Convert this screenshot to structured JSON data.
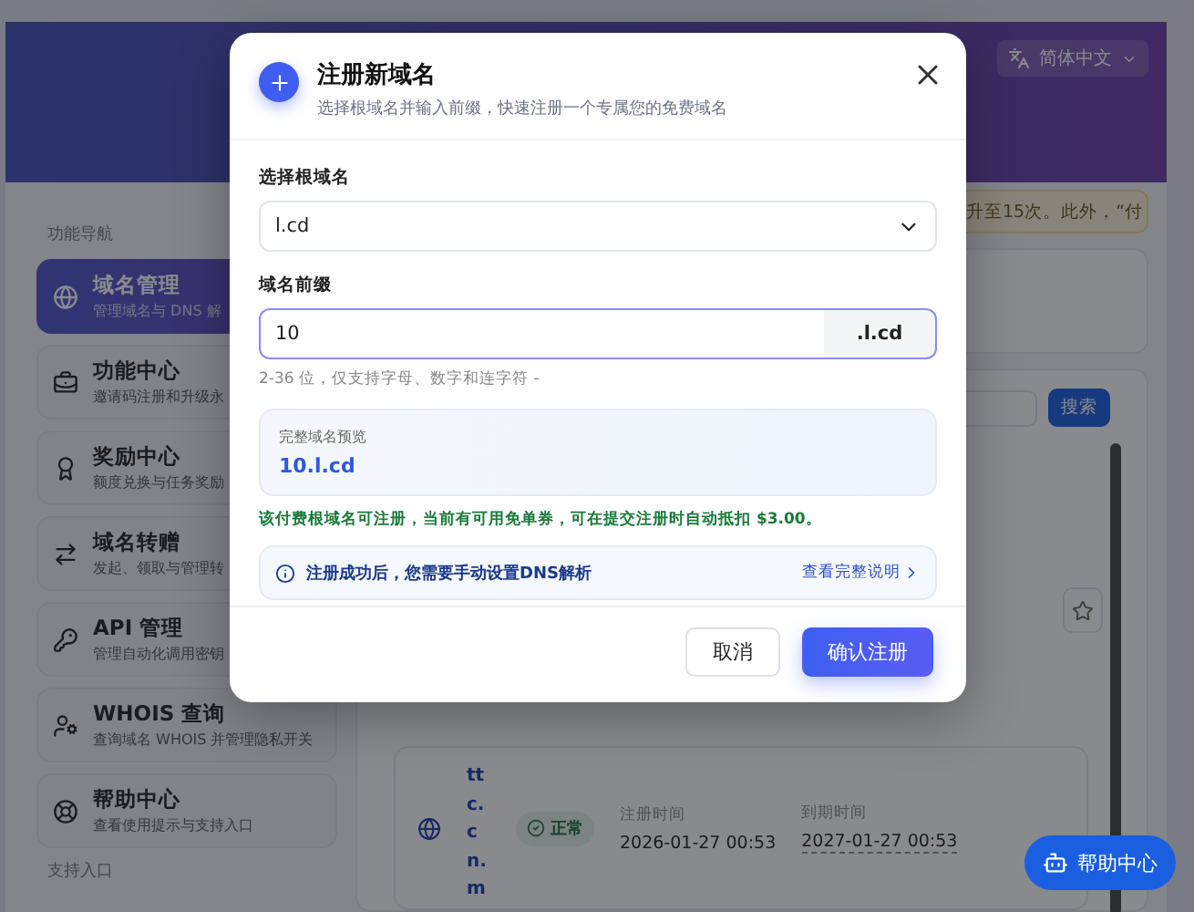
{
  "header": {
    "language": "简体中文"
  },
  "sidebar": {
    "heading": "功能导航",
    "footer_heading": "支持入口",
    "items": [
      {
        "kind": "globe",
        "title": "域名管理",
        "subtitle": "管理域名与 DNS 解",
        "selected": true
      },
      {
        "kind": "toolbox",
        "title": "功能中心",
        "subtitle": "邀请码注册和升级永",
        "selected": false
      },
      {
        "kind": "medal",
        "title": "奖励中心",
        "subtitle": "额度兑换与任务奖励",
        "selected": false
      },
      {
        "kind": "transfer",
        "title": "域名转赠",
        "subtitle": "发起、领取与管理转",
        "selected": false
      },
      {
        "kind": "key",
        "title": "API 管理",
        "subtitle": "管理自动化调用密钥",
        "selected": false
      },
      {
        "kind": "user",
        "title": "WHOIS 查询",
        "subtitle": "查询域名 WHOIS 并管理隐私开关",
        "selected": false
      },
      {
        "kind": "help",
        "title": "帮助中心",
        "subtitle": "查看使用提示与支持入口",
        "selected": false
      }
    ]
  },
  "main": {
    "notice": "升至15次。此外，“付",
    "search_button": "搜索",
    "domain_row": {
      "domain": "ttc.cn.m",
      "status": "正常",
      "registered_label": "注册时间",
      "registered": "2026-01-27 00:53",
      "expires_label": "到期时间",
      "expires": "2027-01-27 00:53"
    }
  },
  "help_button": "帮助中心",
  "dialog": {
    "title": "注册新域名",
    "subtitle": "选择根域名并输入前缀，快速注册一个专属您的免费域名",
    "root_label": "选择根域名",
    "root_value": "l.cd",
    "prefix_label": "域名前缀",
    "prefix_value": "10",
    "prefix_suffix": ".l.cd",
    "hint": "2-36 位，仅支持字母、数字和连字符 -",
    "preview_label": "完整域名预览",
    "preview_value": "10.l.cd",
    "message": "该付费根域名可注册，当前有可用免单券，可在提交注册时自动抵扣 $3.00。",
    "info": "注册成功后，您需要手动设置DNS解析",
    "info_link": "查看完整说明",
    "cancel": "取消",
    "confirm": "确认注册"
  }
}
